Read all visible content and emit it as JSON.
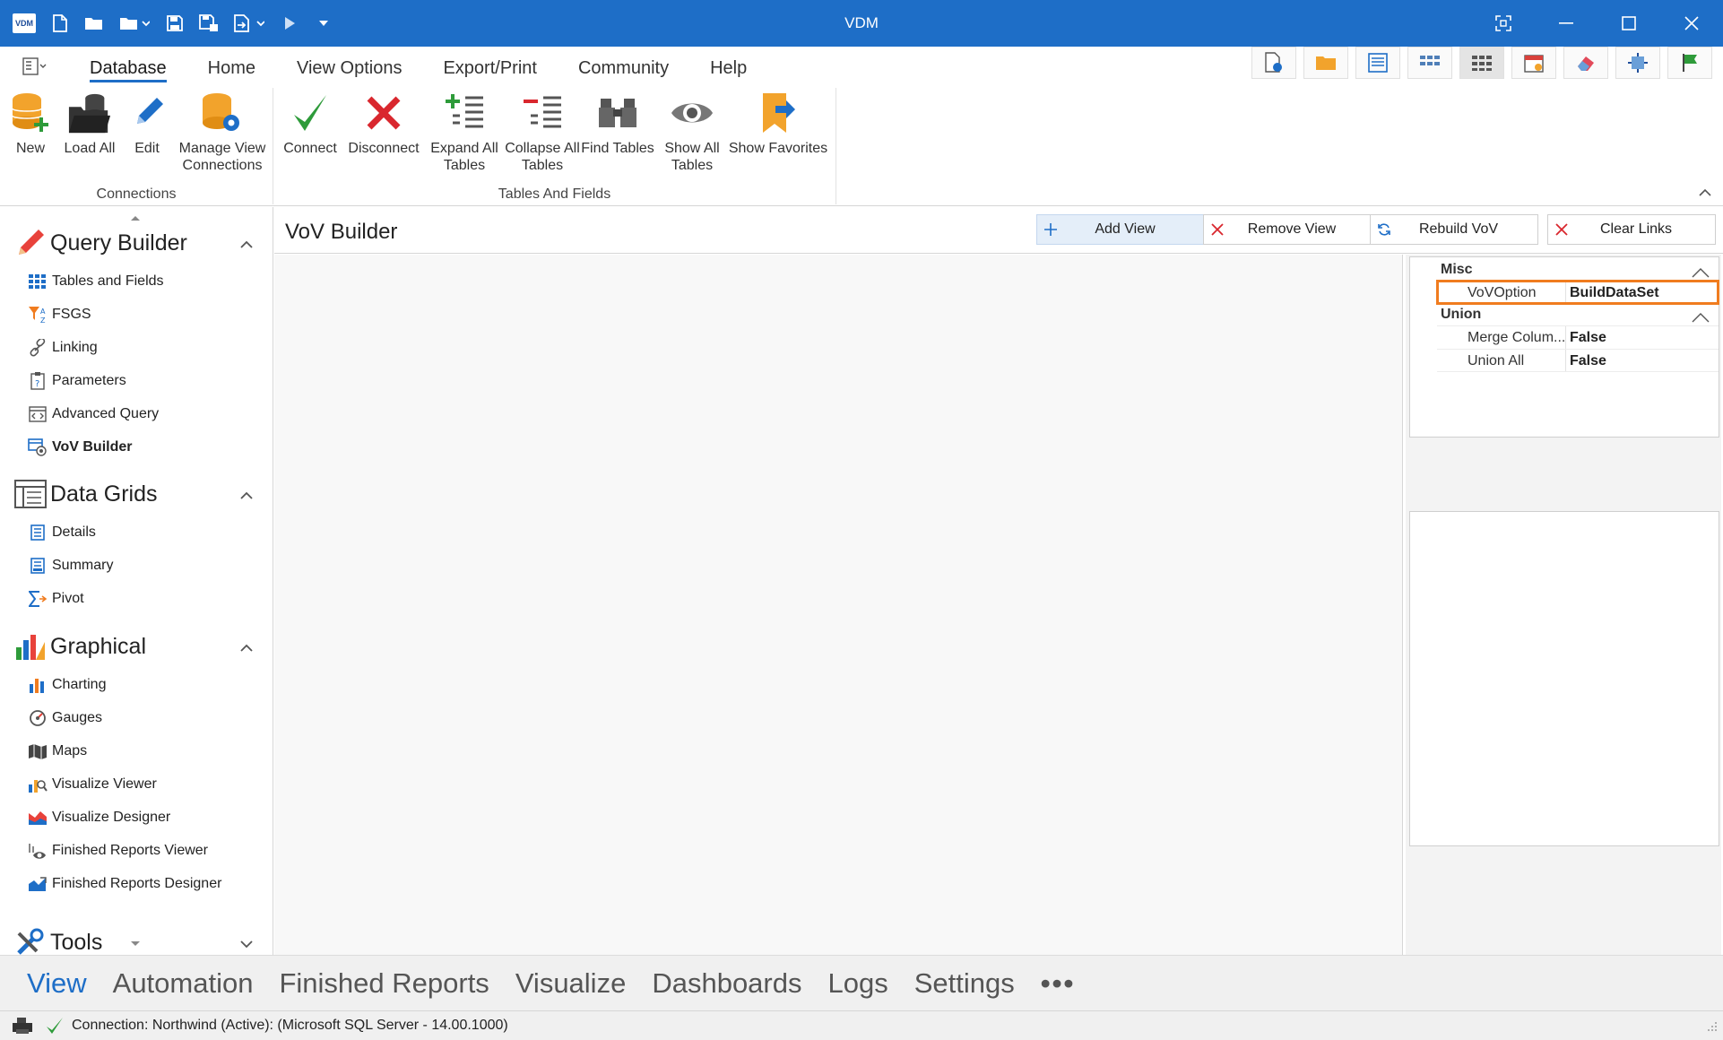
{
  "titlebar": {
    "title": "VDM",
    "logo_text": "VDM",
    "quick_access": [
      "new-file-icon",
      "open-folder-icon",
      "open-recent-icon",
      "save-icon",
      "save-all-icon",
      "export-icon",
      "run-icon",
      "customize-icon"
    ]
  },
  "ribbon": {
    "tabs": [
      "Database",
      "Home",
      "View Options",
      "Export/Print",
      "Community",
      "Help"
    ],
    "active_tab": "Database",
    "groups": {
      "connections": {
        "label": "Connections",
        "buttons": {
          "new": "New",
          "load_all": "Load All",
          "edit": "Edit",
          "manage_view_connections": "Manage View Connections"
        }
      },
      "tables_and_fields": {
        "label": "Tables And Fields",
        "buttons": {
          "connect": "Connect",
          "disconnect": "Disconnect",
          "expand_all_tables": "Expand All Tables",
          "collapse_all_tables": "Collapse All Tables",
          "find_tables": "Find Tables",
          "show_all_tables": "Show All Tables",
          "show_favorites": "Show Favorites"
        }
      }
    }
  },
  "sidenav": {
    "query_builder": {
      "title": "Query Builder",
      "items": [
        "Tables and Fields",
        "FSGS",
        "Linking",
        "Parameters",
        "Advanced Query",
        "VoV Builder"
      ],
      "active": "VoV Builder"
    },
    "data_grids": {
      "title": "Data Grids",
      "items": [
        "Details",
        "Summary",
        "Pivot"
      ]
    },
    "graphical": {
      "title": "Graphical",
      "items": [
        "Charting",
        "Gauges",
        "Maps",
        "Visualize Viewer",
        "Visualize Designer",
        "Finished Reports Viewer",
        "Finished Reports Designer"
      ]
    },
    "tools": {
      "title": "Tools"
    }
  },
  "content": {
    "title": "VoV Builder",
    "buttons": {
      "add_view": "Add View",
      "remove_view": "Remove View",
      "rebuild_vov": "Rebuild VoV",
      "clear_links": "Clear Links"
    }
  },
  "properties": {
    "misc": {
      "label": "Misc",
      "rows": [
        {
          "name": "VoVOption",
          "value": "BuildDataSet"
        }
      ]
    },
    "union": {
      "label": "Union",
      "rows": [
        {
          "name": "Merge Colum...",
          "value": "False"
        },
        {
          "name": "Union All",
          "value": "False"
        }
      ]
    }
  },
  "bottomnav": {
    "items": [
      "View",
      "Automation",
      "Finished Reports",
      "Visualize",
      "Dashboards",
      "Logs",
      "Settings"
    ],
    "active": "View",
    "more": "•••"
  },
  "status": {
    "text": "Connection: Northwind (Active): (Microsoft SQL Server - 14.00.1000)"
  },
  "colors": {
    "titlebar": "#1e6ec7",
    "accent": "#1e6ec7",
    "selection_outline": "#f07c1f"
  }
}
